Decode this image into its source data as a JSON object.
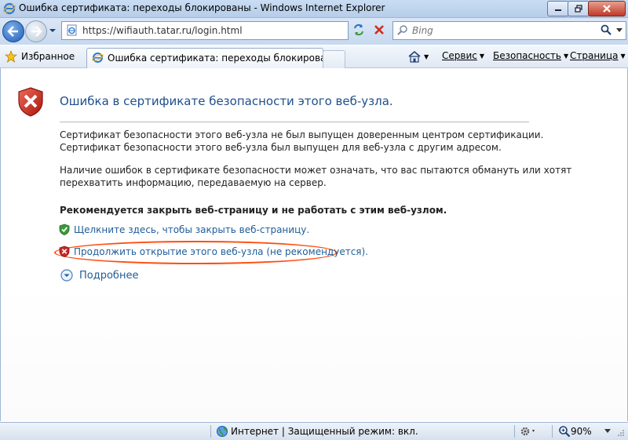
{
  "window": {
    "title": "Ошибка сертификата: переходы блокированы - Windows Internet Explorer"
  },
  "address_bar": {
    "url": "https://wifiauth.tatar.ru/login.html",
    "search_placeholder": "Bing"
  },
  "favorites_bar": {
    "favorites_label": "Избранное",
    "tab_title": "Ошибка сертификата: переходы блокированы",
    "commands": {
      "service": "Сервис",
      "security": "Безопасность",
      "page": "Страница"
    }
  },
  "content": {
    "title": "Ошибка в сертификате безопасности этого веб-узла.",
    "para1_line1": "Сертификат безопасности этого веб-узла не был выпущен доверенным центром сертификации.",
    "para1_line2": "Сертификат безопасности этого веб-узла был выпущен для веб-узла с другим адресом.",
    "para2_line1": "Наличие ошибок в сертификате безопасности может означать, что вас пытаются обмануть или хотят",
    "para2_line2": "перехватить информацию, передаваемую на сервер.",
    "recommendation": "Рекомендуется закрыть веб-страницу и не работать с этим веб-узлом.",
    "close_link": "Щелкните здесь, чтобы закрыть веб-страницу.",
    "continue_link": "Продолжить открытие этого веб-узла (не рекомендуется).",
    "more_info": "Подробнее"
  },
  "status_bar": {
    "zone": "Интернет | Защищенный режим: вкл.",
    "zoom": "90%"
  },
  "colors": {
    "link": "#1f5c99",
    "title": "#1f4e8c",
    "highlight": "#ff4d0f",
    "error_red": "#c62828",
    "safe_green": "#3a9a3a"
  }
}
